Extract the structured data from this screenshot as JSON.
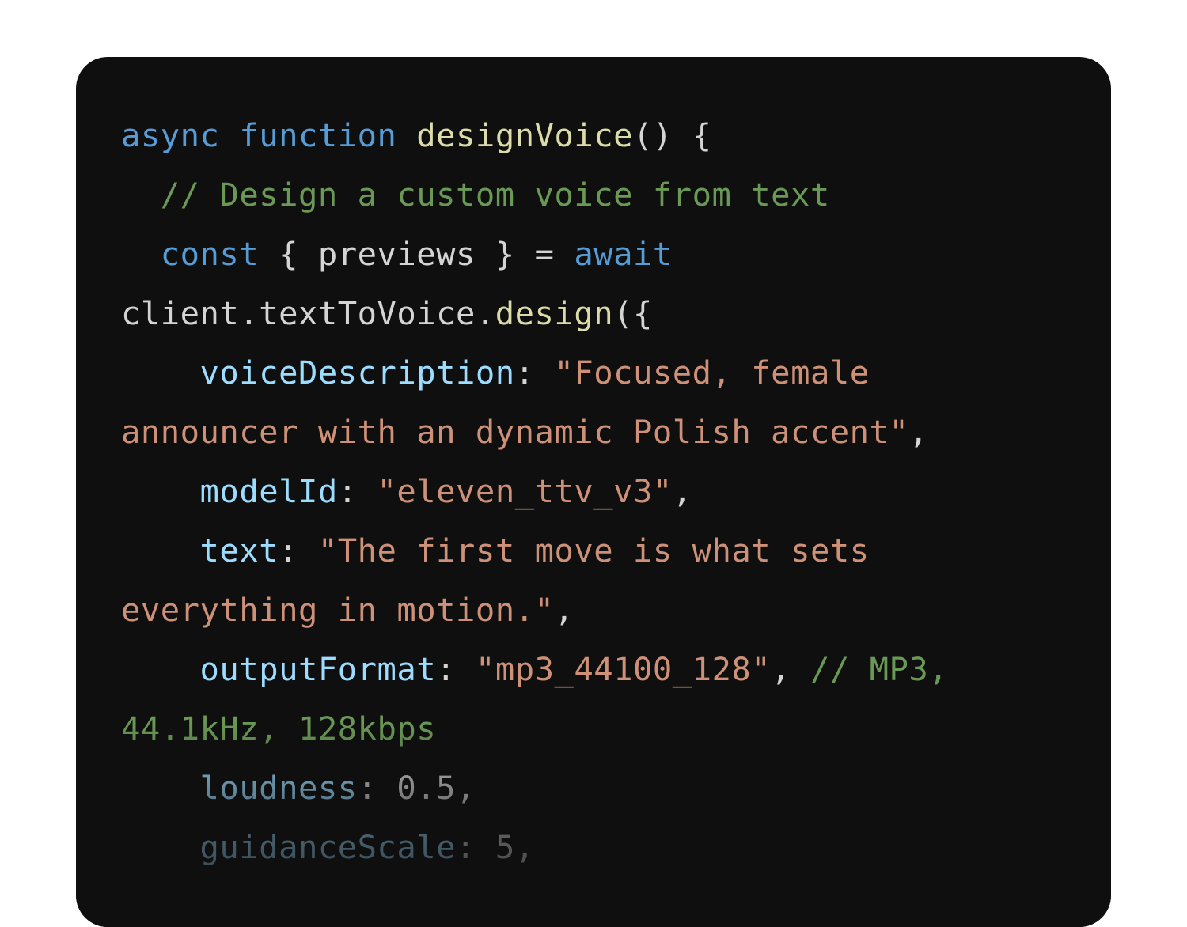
{
  "code": {
    "l1": {
      "kw_async": "async",
      "kw_function": "function",
      "fn_name": "designVoice",
      "rest": "() {"
    },
    "l2": {
      "comment": "// Design a custom voice from text"
    },
    "l3": {
      "kw_const": "const",
      "mid": "{ previews } =",
      "kw_await": "await"
    },
    "l4": {
      "obj": "client.textToVoice.",
      "method": "design",
      "rest": "({"
    },
    "l5": {
      "prop": "voiceDescription",
      "colon": ":",
      "str": "\"Focused, female"
    },
    "l6": {
      "str": "announcer with an dynamic Polish accent\"",
      "comma": ","
    },
    "l7": {
      "prop": "modelId",
      "colon": ":",
      "str": "\"eleven_ttv_v3\"",
      "comma": ","
    },
    "l8": {
      "prop": "text",
      "colon": ":",
      "str": "\"The first move is what sets"
    },
    "l9": {
      "str": "everything in motion.\"",
      "comma": ","
    },
    "l10": {
      "prop": "outputFormat",
      "colon": ":",
      "str": "\"mp3_44100_128\"",
      "comma": ",",
      "comment": "// MP3,"
    },
    "l11": {
      "comment": "44.1kHz, 128kbps"
    },
    "l12": {
      "prop": "loudness",
      "colon": ":",
      "num": "0.5",
      "comma": ","
    },
    "l13": {
      "prop": "guidanceScale",
      "colon": ":",
      "num": "5",
      "comma": ","
    }
  },
  "colors": {
    "card_background": "#0f0f0f",
    "page_background": "#ffffff",
    "keyword": "#569cd6",
    "function": "#dcdcaa",
    "comment": "#6a9955",
    "property": "#9cdcfe",
    "string": "#ce9178",
    "plain": "#d4d4d4"
  }
}
